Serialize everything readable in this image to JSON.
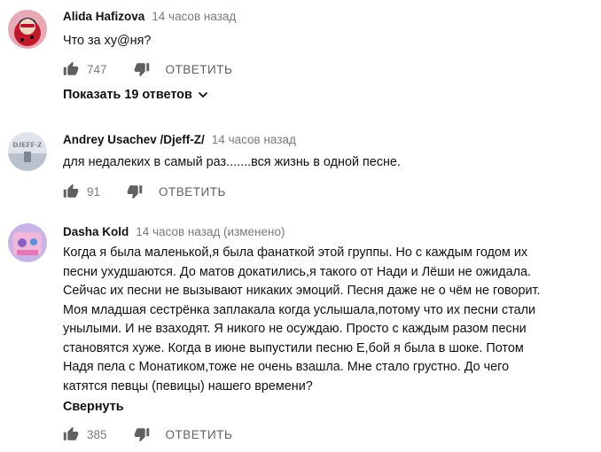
{
  "comments": [
    {
      "author": "Alida Hafizova",
      "time": "14 часов назад",
      "text_lines": [
        "Что за ху@ня?"
      ],
      "likes": "747",
      "reply_label": "ОТВЕТИТЬ",
      "show_replies": "Показать 19 ответов"
    },
    {
      "author": "Andrey Usachev /Djeff-Z/",
      "time": "14 часов назад",
      "avatar_text": "DJEFF-Z",
      "text_lines": [
        "для недалеких в самый раз.......вся жизнь в одной песне."
      ],
      "likes": "91",
      "reply_label": "ОТВЕТИТЬ"
    },
    {
      "author": "Dasha Kold",
      "time": "14 часов назад (изменено)",
      "text_lines": [
        "Когда я была маленькой,я была фанаткой этой группы. Но с каждым годом  их",
        "песни ухудшаются. До матов докатились,я такого от Нади и Лёши не ожидала.",
        "Сейчас их песни не вызывают никаких эмоций. Песня даже не о чём не говорит.",
        "Моя младшая сестрёнка заплакала когда услышала,потому что их песни стали",
        "унылыми. И не взаходят. Я никого не осуждаю. Просто с каждым разом песни",
        "становятся хуже. Когда в июне выпустили песню Е,бой я была в шоке. Потом",
        "Надя пела с Монатиком,тоже не очень взашла. Мне стало грустно. До чего",
        "катятся певцы (певицы) нашего времени?"
      ],
      "collapse_label": "Свернуть",
      "likes": "385",
      "reply_label": "ОТВЕТИТЬ"
    }
  ],
  "colors": {
    "text": "#111111",
    "meta": "#7a7a7a",
    "icon": "#606060"
  }
}
